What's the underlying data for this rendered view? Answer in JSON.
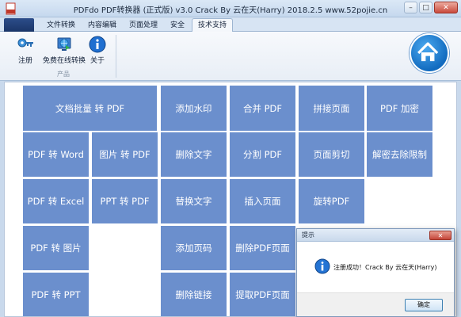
{
  "window": {
    "title": "PDFdo  PDF转换器 (正式版) v3.0  Crack By 云在天(Harry)  2018.2.5  www.52pojie.cn",
    "minimize": "–",
    "maximize": "□",
    "close": "✕"
  },
  "tabs": [
    {
      "label": "文件转换"
    },
    {
      "label": "内容编辑"
    },
    {
      "label": "页面处理"
    },
    {
      "label": "安全"
    },
    {
      "label": "技术支持",
      "active": true
    }
  ],
  "ribbon": {
    "buttons": [
      {
        "label": "注册",
        "icon": "key-icon"
      },
      {
        "label": "免费在线转换",
        "icon": "globe-icon"
      },
      {
        "label": "关于",
        "icon": "info-icon"
      }
    ],
    "group_label": "产品",
    "home_icon": "home-icon"
  },
  "grid": [
    {
      "label": "文档批量 转 PDF",
      "wide": true
    },
    {
      "label": "添加水印"
    },
    {
      "label": "合并 PDF"
    },
    {
      "label": "拼接页面"
    },
    {
      "label": "PDF 加密"
    },
    {
      "label": "PDF 转 Word"
    },
    {
      "label": "图片 转 PDF"
    },
    {
      "label": "删除文字"
    },
    {
      "label": "分割 PDF"
    },
    {
      "label": "页面剪切"
    },
    {
      "label": "解密去除限制"
    },
    {
      "label": "PDF 转 Excel"
    },
    {
      "label": "PPT 转 PDF"
    },
    {
      "label": "替换文字"
    },
    {
      "label": "插入页面"
    },
    {
      "label": "旋转PDF"
    },
    {
      "label": "PDF 转 图片"
    },
    {
      "label": "添加页码"
    },
    {
      "label": "删除PDF页面"
    },
    {
      "label": "PDF 转 PPT"
    },
    {
      "label": "删除链接"
    },
    {
      "label": "提取PDF页面"
    }
  ],
  "dialog": {
    "title": "提示",
    "close": "✕",
    "message": "注册成功！Crack By 云在天(Harry)",
    "ok": "确定",
    "icon": "info-icon"
  },
  "colors": {
    "tile": "#6b8fcd",
    "accent": "#126bbf"
  }
}
